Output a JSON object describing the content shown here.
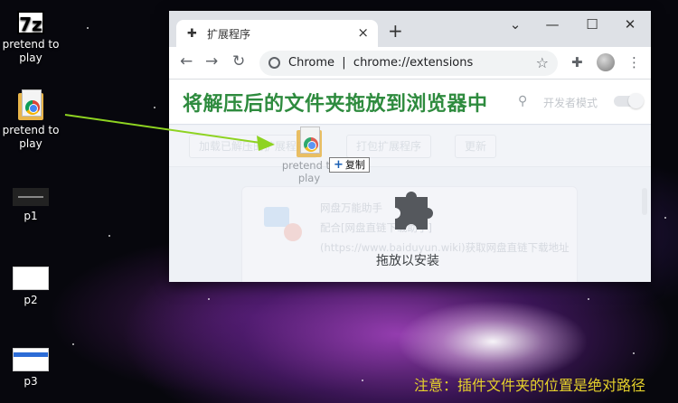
{
  "desktop": {
    "icons": [
      {
        "label": "pretend to play",
        "glyph": "7z"
      },
      {
        "label": "pretend to play"
      },
      {
        "label": "p1"
      },
      {
        "label": "p2"
      },
      {
        "label": "p3"
      }
    ]
  },
  "browser": {
    "tab": {
      "title": "扩展程序"
    },
    "address": {
      "scheme_label": "Chrome",
      "separator": "|",
      "url": "chrome://extensions"
    },
    "page": {
      "overlay_title": "将解压后的文件夹拖放到浏览器中",
      "dev_mode_label": "开发者模式",
      "toolbar_buttons": [
        "加载已解压的扩展程序",
        "打包扩展程序",
        "更新"
      ],
      "extension_card": {
        "name": "网盘万能助手",
        "description": "配合[网盘直链下载助手](https://www.baiduyun.wiki)获取网盘直链下载地址"
      },
      "drop_label": "拖放以安装"
    }
  },
  "drag": {
    "item_label": "pretend to play",
    "action_label": "复制",
    "action_symbol": "+"
  },
  "annotation": {
    "note": "注意：插件文件夹的位置是绝对路径",
    "arrow_color": "#8ed321"
  }
}
